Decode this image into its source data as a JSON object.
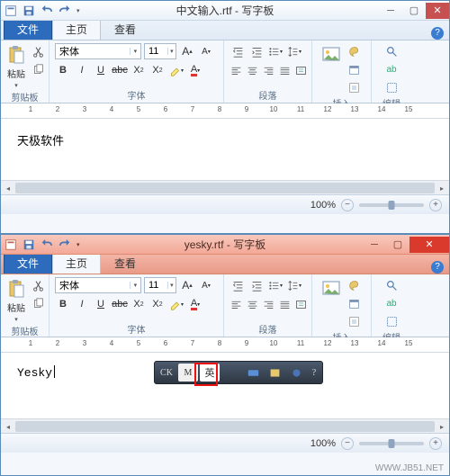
{
  "win1": {
    "title": "中文输入.rtf - 写字板",
    "document_text": "天极软件",
    "zoom": "100%"
  },
  "win2": {
    "title": "yesky.rtf - 写字板",
    "document_text": "Yesky",
    "zoom": "100%"
  },
  "tabs": {
    "file": "文件",
    "home": "主页",
    "view": "查看"
  },
  "ribbon": {
    "clipboard": {
      "label": "剪贴板",
      "paste": "粘贴"
    },
    "font": {
      "label": "字体",
      "name": "宋体",
      "size": "11"
    },
    "paragraph": {
      "label": "段落"
    },
    "insert": {
      "label": "插入"
    },
    "edit": {
      "label": "编辑"
    }
  },
  "ruler": [
    "1",
    "2",
    "3",
    "4",
    "5",
    "6",
    "7",
    "8",
    "9",
    "10",
    "11",
    "12",
    "13",
    "14",
    "15"
  ],
  "langbar": {
    "ck": "CK",
    "m": "M",
    "ch": "英"
  },
  "watermark": "WWW.JB51.NET"
}
